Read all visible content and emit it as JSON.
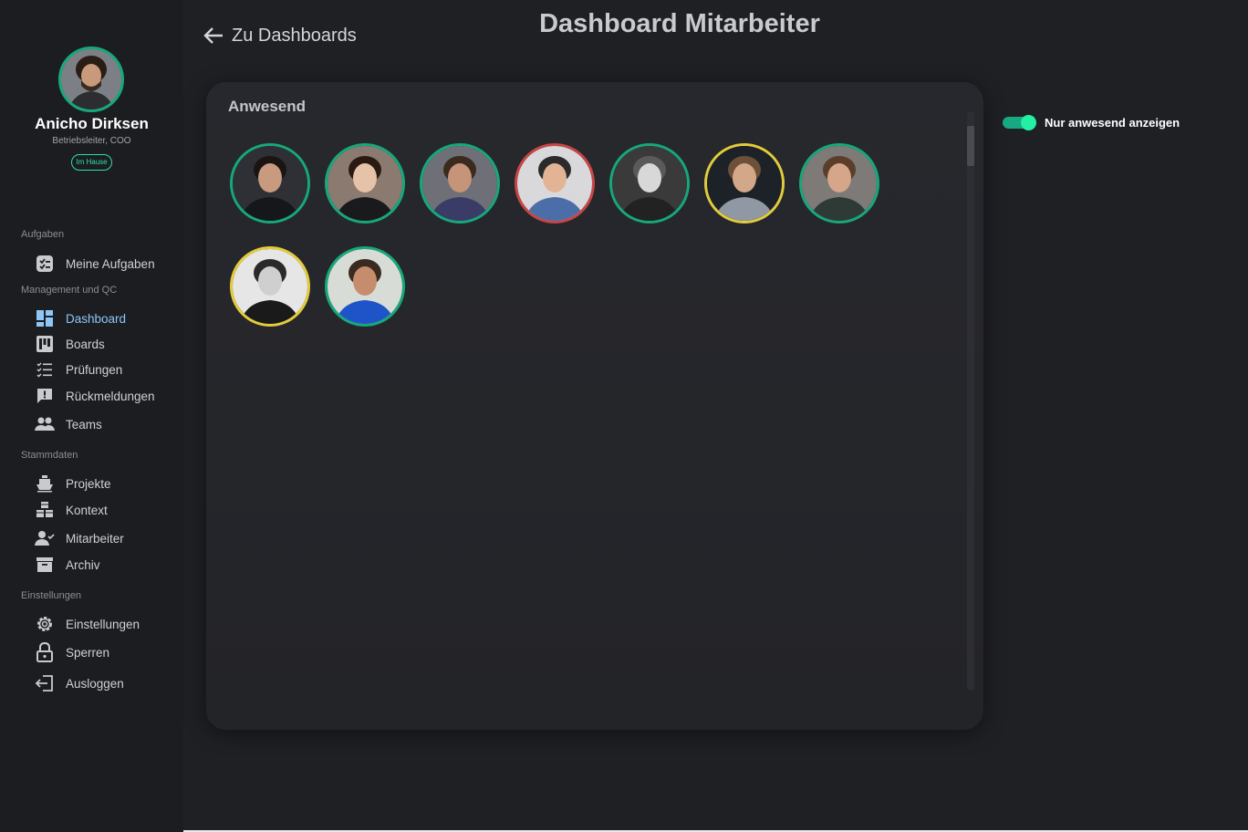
{
  "profile": {
    "name": "Anicho Dirksen",
    "role": "Betriebsleiter, COO",
    "status": "Im Hause",
    "avatar": "user-avatar"
  },
  "nav": {
    "sections": [
      {
        "title": "Aufgaben",
        "items": [
          {
            "label": "Meine Aufgaben",
            "icon": "tasks-icon"
          }
        ]
      },
      {
        "title": "Management und QC",
        "items": [
          {
            "label": "Dashboard",
            "icon": "dashboard-icon",
            "active": true
          },
          {
            "label": "Boards",
            "icon": "boards-icon"
          },
          {
            "label": "Prüfungen",
            "icon": "checklist-icon"
          },
          {
            "label": "Rückmeldungen",
            "icon": "feedback-icon"
          },
          {
            "label": "Teams",
            "icon": "teams-icon"
          }
        ]
      },
      {
        "title": "Stammdaten",
        "items": [
          {
            "label": "Projekte",
            "icon": "ship-icon"
          },
          {
            "label": "Kontext",
            "icon": "cubes-icon"
          },
          {
            "label": "Mitarbeiter",
            "icon": "user-check-icon"
          },
          {
            "label": "Archiv",
            "icon": "archive-icon"
          }
        ]
      },
      {
        "title": "Einstellungen",
        "items": [
          {
            "label": "Einstellungen",
            "icon": "gear-icon"
          },
          {
            "label": "Sperren",
            "icon": "lock-icon"
          },
          {
            "label": "Ausloggen",
            "icon": "logout-icon"
          }
        ]
      }
    ]
  },
  "header": {
    "back_label": "Zu Dashboards",
    "title": "Dashboard Mitarbeiter"
  },
  "panel": {
    "title": "Anwesend",
    "employees": [
      {
        "ring": "#15a97a",
        "skin": "#c89a80",
        "hair": "#1a1512",
        "shirt": "#15171b",
        "bg": "#2e3036"
      },
      {
        "ring": "#15a97a",
        "skin": "#e6c2a8",
        "hair": "#2a1a12",
        "shirt": "#1a1a1c",
        "bg": "#8a7a70"
      },
      {
        "ring": "#15a97a",
        "skin": "#c69478",
        "hair": "#3b2a1e",
        "shirt": "#3a3b66",
        "bg": "#6f7077"
      },
      {
        "ring": "#c94545",
        "skin": "#e2b495",
        "hair": "#2b2b2b",
        "shirt": "#4b6ea8",
        "bg": "#d9d9db"
      },
      {
        "ring": "#15a97a",
        "skin": "#d8d8d8",
        "hair": "#5a5a5a",
        "shirt": "#222222",
        "bg": "#3a3a3a"
      },
      {
        "ring": "#e3cc3a",
        "skin": "#d2a888",
        "hair": "#6d5038",
        "shirt": "#8f98a3",
        "bg": "#1d2228"
      },
      {
        "ring": "#15a97a",
        "skin": "#d5a68a",
        "hair": "#5a3e2a",
        "shirt": "#2e3a36",
        "bg": "#7d7a78"
      },
      {
        "ring": "#e3cc3a",
        "skin": "#cfcfcf",
        "hair": "#2a2a2a",
        "shirt": "#1a1a1a",
        "bg": "#e6e6e6"
      },
      {
        "ring": "#15a97a",
        "skin": "#c58d6e",
        "hair": "#3a2a20",
        "shirt": "#1f54c8",
        "bg": "#d8dcd6"
      }
    ]
  },
  "toggle": {
    "label": "Nur anwesend anzeigen",
    "on": true
  },
  "colors": {
    "accent": "#17a981",
    "active_nav": "#8ec6f7"
  }
}
